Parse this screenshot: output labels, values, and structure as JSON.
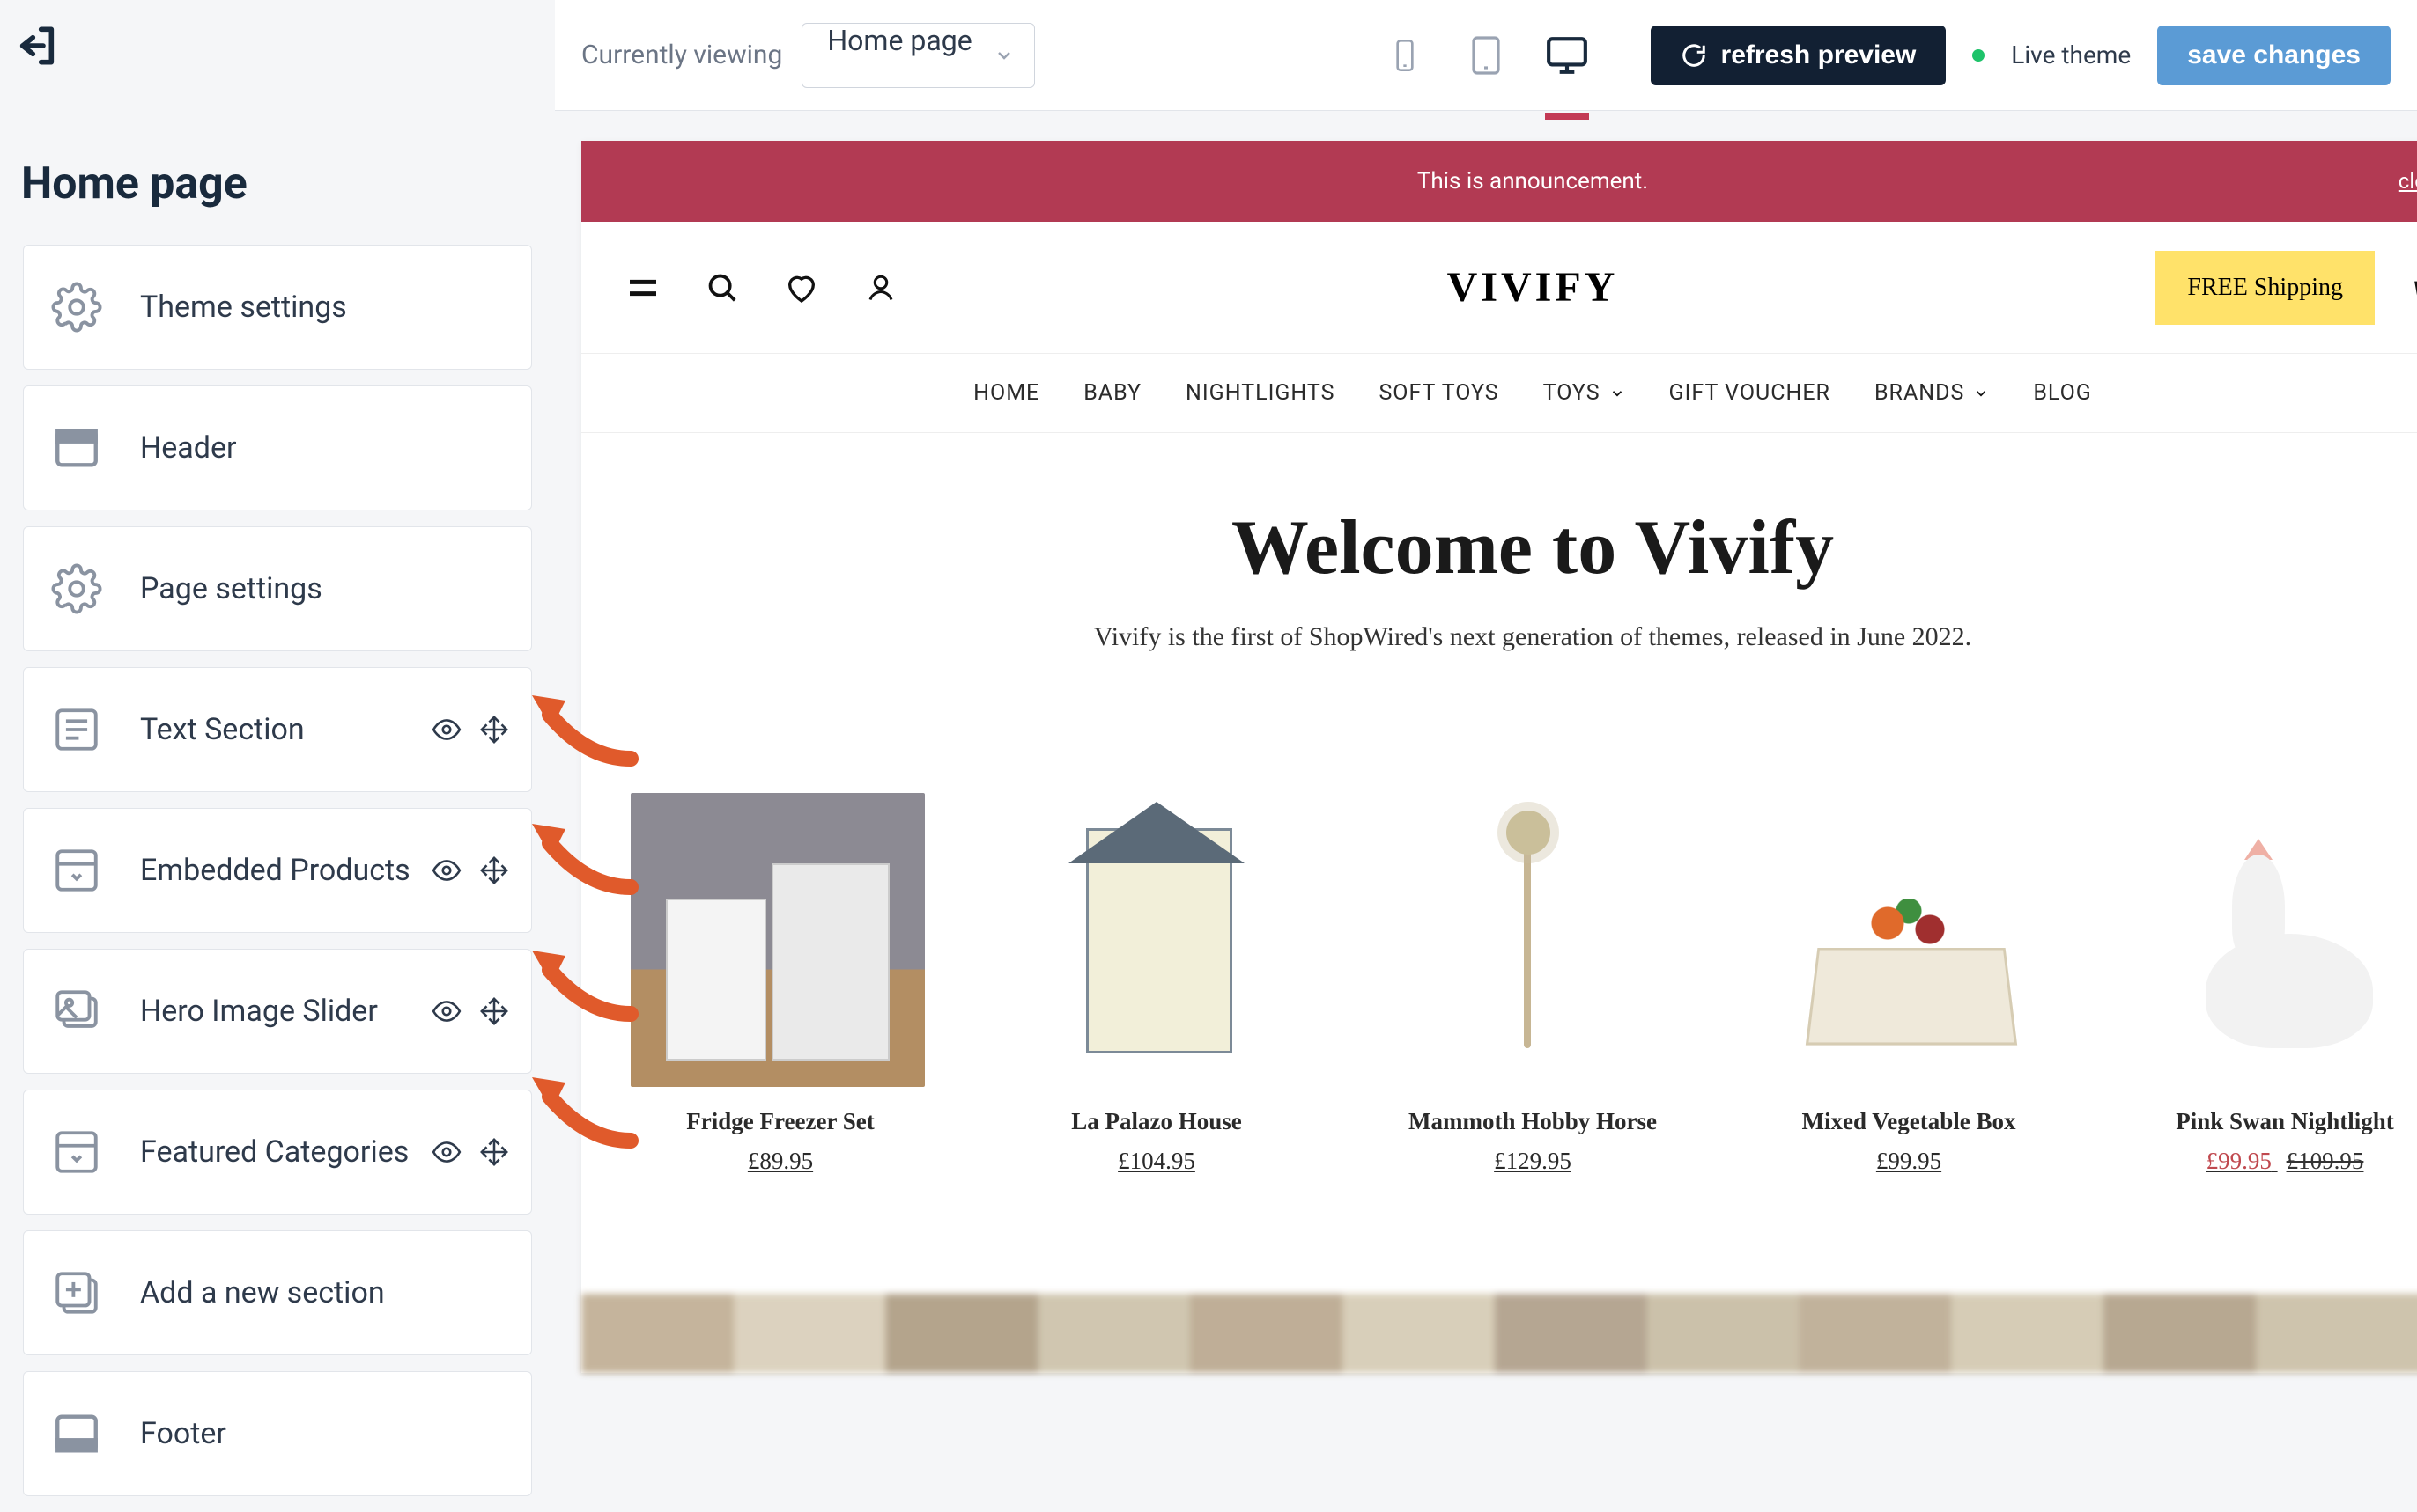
{
  "toolbar": {
    "viewing_label": "Currently viewing",
    "page_select_value": "Home page",
    "refresh_label": "refresh preview",
    "theme_status": "Live theme",
    "save_label": "save changes"
  },
  "sidebar": {
    "title": "Home page",
    "items": [
      {
        "label": "Theme settings",
        "icon": "gear",
        "has_controls": false
      },
      {
        "label": "Header",
        "icon": "layout-header",
        "has_controls": false
      },
      {
        "label": "Page settings",
        "icon": "gear",
        "has_controls": false
      },
      {
        "label": "Text Section",
        "icon": "text-block",
        "has_controls": true
      },
      {
        "label": "Embedded Products",
        "icon": "grid-collapse",
        "has_controls": true
      },
      {
        "label": "Hero Image Slider",
        "icon": "images-stack",
        "has_controls": true
      },
      {
        "label": "Featured Categories",
        "icon": "grid-collapse",
        "has_controls": true
      },
      {
        "label": "Add a new section",
        "icon": "plus-square",
        "has_controls": false
      },
      {
        "label": "Footer",
        "icon": "layout-footer",
        "has_controls": false
      }
    ]
  },
  "announcement": {
    "text": "This is announcement.",
    "close": "close"
  },
  "storefront": {
    "brand": "VIVIFY",
    "free_shipping": "FREE Shipping",
    "nav": [
      "HOME",
      "BABY",
      "NIGHTLIGHTS",
      "SOFT TOYS",
      "TOYS",
      "GIFT VOUCHER",
      "BRANDS",
      "BLOG"
    ],
    "nav_has_dropdown": [
      false,
      false,
      false,
      false,
      true,
      false,
      true,
      false
    ],
    "hero_title": "Welcome to Vivify",
    "hero_sub": "Vivify is the first of ShopWired's next generation of themes, released in June 2022.",
    "products": [
      {
        "name": "Fridge Freezer Set",
        "price": "£89.95",
        "ph": "kitchen"
      },
      {
        "name": "La Palazo House",
        "price": "£104.95",
        "ph": "dollhouse"
      },
      {
        "name": "Mammoth Hobby Horse",
        "price": "£129.95",
        "ph": "horse"
      },
      {
        "name": "Mixed Vegetable Box",
        "price": "£99.95",
        "ph": "veg"
      },
      {
        "name": "Pink Swan Nightlight",
        "sale_price": "£99.95",
        "orig_price": "£109.95",
        "ph": "swan"
      }
    ]
  }
}
